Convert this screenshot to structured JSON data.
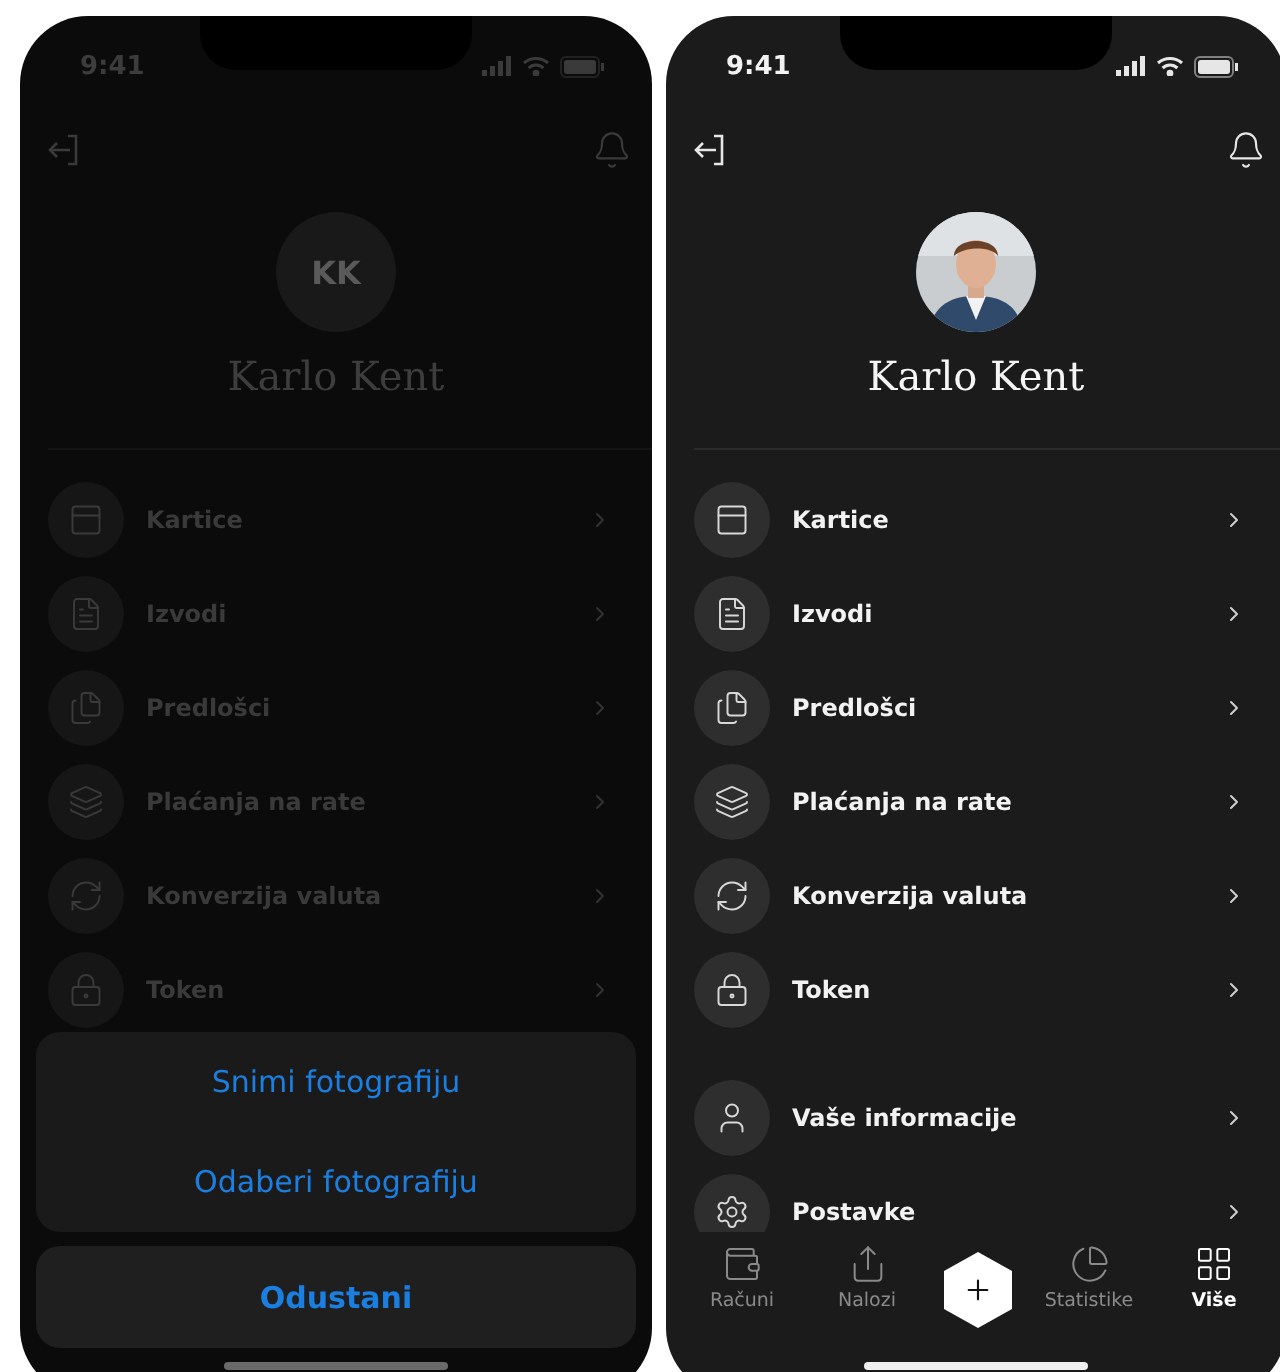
{
  "screens": [
    {
      "kind": "dimmed",
      "status_time": "9:41",
      "avatar": {
        "kind": "initials",
        "initials": "KK"
      },
      "name": "Karlo Kent",
      "menu_groups": [
        [
          {
            "label": "Kartice"
          },
          {
            "label": "Izvodi"
          },
          {
            "label": "Predlošci"
          },
          {
            "label": "Plaćanja na rate"
          },
          {
            "label": "Konverzija valuta"
          },
          {
            "label": "Token"
          }
        ]
      ],
      "action_sheet": {
        "options": [
          "Snimi fotografiju",
          "Odaberi fotografiju"
        ],
        "cancel": "Odustani"
      }
    },
    {
      "kind": "normal",
      "status_time": "9:41",
      "name": "Karlo Kent",
      "menu_groups": [
        [
          {
            "label": "Kartice"
          },
          {
            "label": "Izvodi"
          },
          {
            "label": "Predlošci"
          },
          {
            "label": "Plaćanja na rate"
          },
          {
            "label": "Konverzija valuta"
          },
          {
            "label": "Token"
          }
        ],
        [
          {
            "label": "Vaše informacije"
          },
          {
            "label": "Postavke"
          }
        ]
      ],
      "tab_bar": [
        {
          "label": "Računi",
          "selected": false
        },
        {
          "label": "Nalozi",
          "selected": false
        },
        {
          "label": "Statistike",
          "selected": false
        },
        {
          "label": "Više",
          "selected": true
        }
      ]
    }
  ]
}
